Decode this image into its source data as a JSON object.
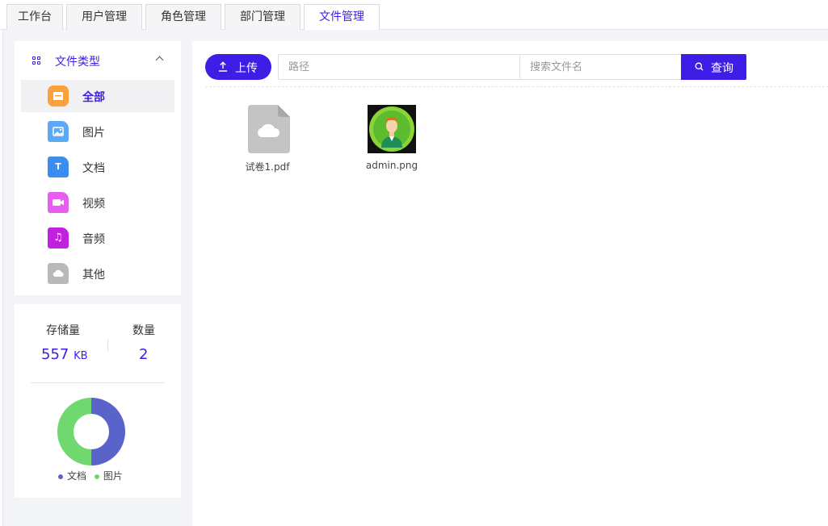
{
  "tabs": [
    {
      "label": "工作台",
      "active": false
    },
    {
      "label": "用户管理",
      "active": false
    },
    {
      "label": "角色管理",
      "active": false
    },
    {
      "label": "部门管理",
      "active": false
    },
    {
      "label": "文件管理",
      "active": true
    }
  ],
  "file_types": {
    "title": "文件类型",
    "items": [
      {
        "label": "全部",
        "icon": "folder-icon",
        "color": "#fba13b",
        "active": true
      },
      {
        "label": "图片",
        "icon": "image-file-icon",
        "color": "#5da9f6",
        "active": false
      },
      {
        "label": "文档",
        "icon": "text-file-icon",
        "color": "#3b8ef0",
        "active": false
      },
      {
        "label": "视频",
        "icon": "video-file-icon",
        "color": "#e65df0",
        "active": false
      },
      {
        "label": "音频",
        "icon": "audio-file-icon",
        "color": "#c21fe0",
        "active": false
      },
      {
        "label": "其他",
        "icon": "cloud-file-icon",
        "color": "#b9b9b9",
        "active": false
      }
    ]
  },
  "stats": {
    "storage_label": "存储量",
    "storage_value": "557",
    "storage_unit": "KB",
    "count_label": "数量",
    "count_value": "2",
    "legend": [
      {
        "label": "文档",
        "color": "#5a63c9",
        "share": 0.5
      },
      {
        "label": "图片",
        "color": "#6fd86f",
        "share": 0.5
      }
    ]
  },
  "toolbar": {
    "upload_label": "上传",
    "path_placeholder": "路径",
    "search_placeholder": "搜索文件名",
    "query_label": "查询"
  },
  "files": [
    {
      "name": "试卷1.pdf",
      "icon": "cloud-file-icon"
    },
    {
      "name": "admin.png",
      "icon": "avatar-thumbnail"
    }
  ],
  "colors": {
    "accent": "#3d1ee6",
    "sidebar_bg": "#f3f4f8"
  }
}
